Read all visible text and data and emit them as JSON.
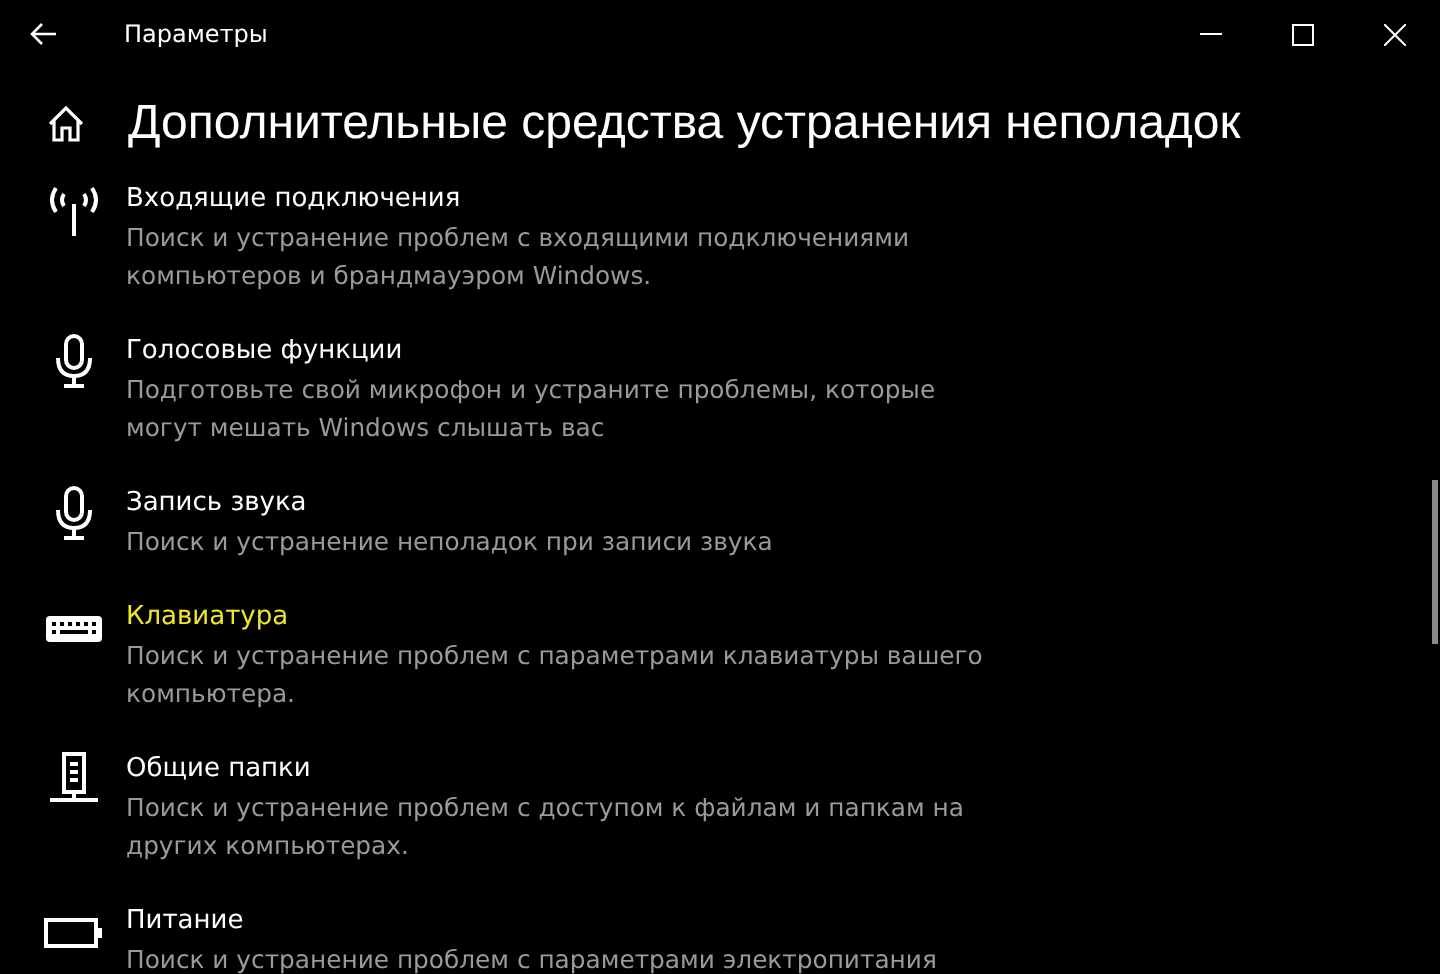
{
  "window": {
    "title": "Параметры"
  },
  "page": {
    "title": "Дополнительные средства устранения неполадок"
  },
  "items": [
    {
      "kind": "antenna",
      "title": "Входящие подключения",
      "description": "Поиск и устранение проблем с входящими подключениями компьютеров и брандмауэром Windows.",
      "selected": false
    },
    {
      "kind": "microphone",
      "title": "Голосовые функции",
      "description": "Подготовьте свой микрофон и устраните проблемы, которые могут мешать Windows слышать вас",
      "selected": false
    },
    {
      "kind": "microphone",
      "title": "Запись звука",
      "description": "Поиск и устранение неполадок при записи звука",
      "selected": false
    },
    {
      "kind": "keyboard",
      "title": "Клавиатура",
      "description": "Поиск и устранение проблем с параметрами клавиатуры вашего компьютера.",
      "selected": true
    },
    {
      "kind": "network",
      "title": "Общие папки",
      "description": "Поиск и устранение проблем с доступом к файлам и папкам на других компьютерах.",
      "selected": false
    },
    {
      "kind": "battery",
      "title": "Питание",
      "description": "Поиск и устранение проблем с параметрами электропитания",
      "selected": false
    }
  ]
}
